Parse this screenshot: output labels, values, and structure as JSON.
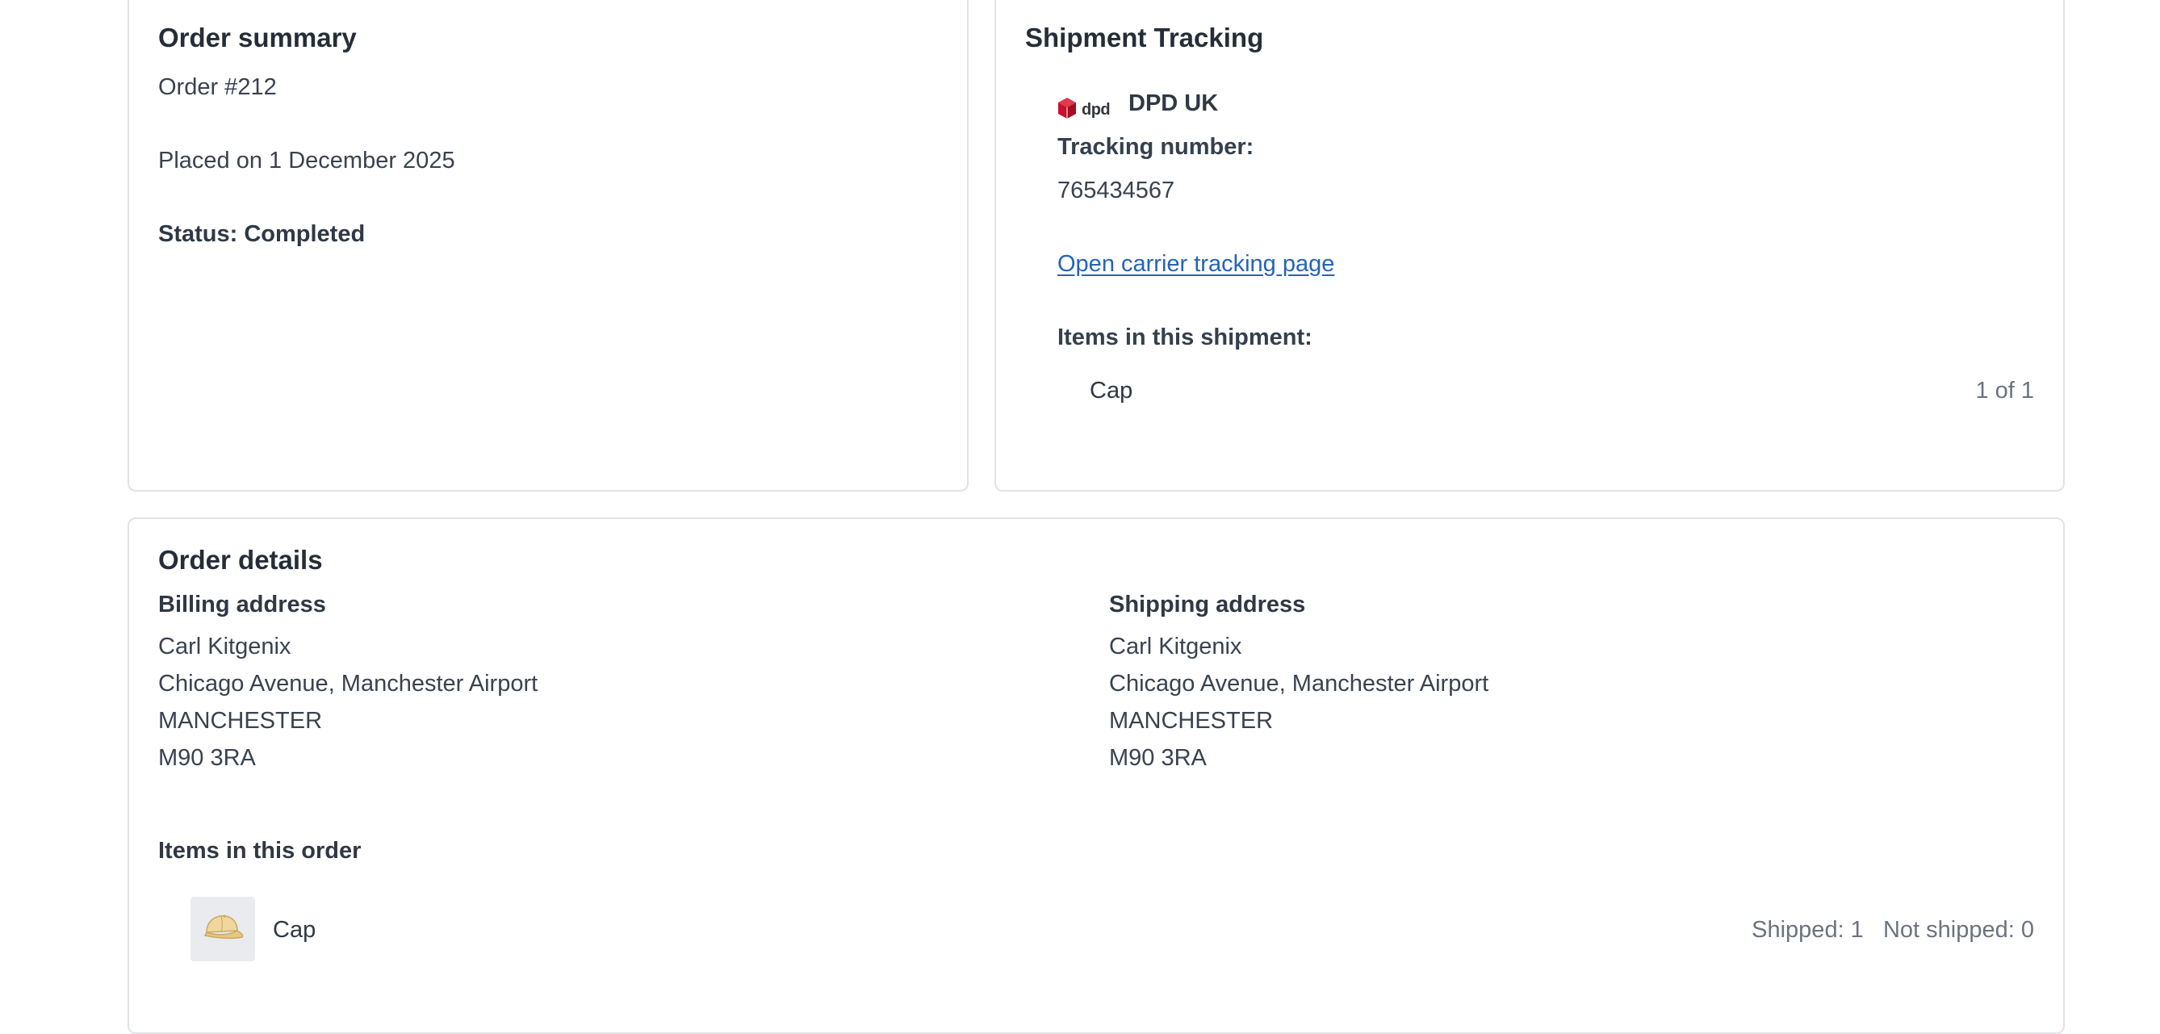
{
  "summary": {
    "title": "Order summary",
    "order_number": "Order #212",
    "placed_on": "Placed on 1 December 2025",
    "status": "Status: Completed"
  },
  "tracking": {
    "title": "Shipment Tracking",
    "carrier_logo_text": "dpd",
    "carrier_name": "DPD UK",
    "tracking_label": "Tracking number:",
    "tracking_number": "765434567",
    "tracking_link": "Open carrier tracking page",
    "items_label": "Items in this shipment:",
    "items": [
      {
        "name": "Cap",
        "count": "1 of 1"
      }
    ],
    "logo_color": "#dc0032"
  },
  "details": {
    "title": "Order details",
    "billing": {
      "label": "Billing address",
      "lines": [
        "Carl Kitgenix",
        "Chicago Avenue, Manchester Airport",
        "MANCHESTER",
        "M90 3RA"
      ]
    },
    "shipping": {
      "label": "Shipping address",
      "lines": [
        "Carl Kitgenix",
        "Chicago Avenue, Manchester Airport",
        "MANCHESTER",
        "M90 3RA"
      ]
    },
    "items_label": "Items in this order",
    "items": [
      {
        "name": "Cap",
        "shipped": "Shipped: 1",
        "not_shipped": "Not shipped: 0",
        "icon": "cap-icon"
      }
    ]
  },
  "colors": {
    "link": "#2563b8",
    "border": "#e1e3e6",
    "text": "#2b3340",
    "muted": "#6c737f"
  }
}
